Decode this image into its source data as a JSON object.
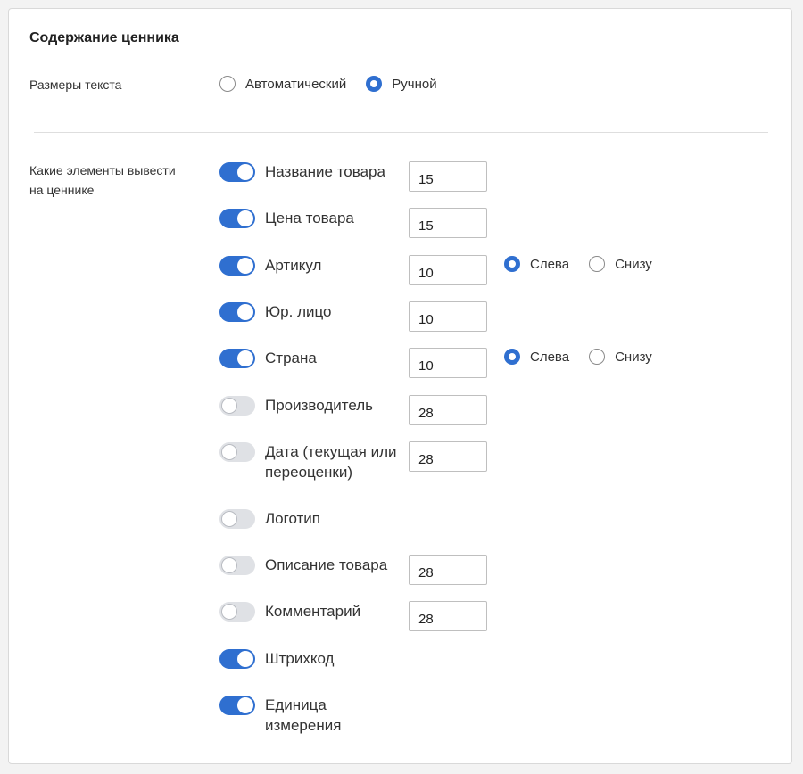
{
  "section": {
    "title": "Содержание ценника"
  },
  "text_size": {
    "label": "Размеры текста",
    "options": [
      {
        "label": "Автоматический",
        "checked": false
      },
      {
        "label": "Ручной",
        "checked": true
      }
    ]
  },
  "elements": {
    "label_line1": "Какие элементы вывести",
    "label_line2": "на ценнике",
    "items": [
      {
        "label": "Название товара",
        "on": true,
        "size": "15"
      },
      {
        "label": "Цена товара",
        "on": true,
        "size": "15"
      },
      {
        "label": "Артикул",
        "on": true,
        "size": "10",
        "position": {
          "left": "Слева",
          "bottom": "Снизу",
          "selected": "left"
        }
      },
      {
        "label": "Юр. лицо",
        "on": true,
        "size": "10"
      },
      {
        "label": "Страна",
        "on": true,
        "size": "10",
        "position": {
          "left": "Слева",
          "bottom": "Снизу",
          "selected": "left"
        }
      },
      {
        "label": "Производитель",
        "on": false,
        "size": "28"
      },
      {
        "label": "Дата (текущая или переоценки)",
        "on": false,
        "size": "28"
      },
      {
        "label": "Логотип",
        "on": false
      },
      {
        "label": "Описание товара",
        "on": false,
        "size": "28"
      },
      {
        "label": "Комментарий",
        "on": false,
        "size": "28"
      },
      {
        "label": "Штрихкод",
        "on": true
      },
      {
        "label": "Единица измерения",
        "on": true
      }
    ]
  },
  "colors": {
    "accent": "#2f6fd0",
    "toggle_off": "#dfe1e5"
  }
}
